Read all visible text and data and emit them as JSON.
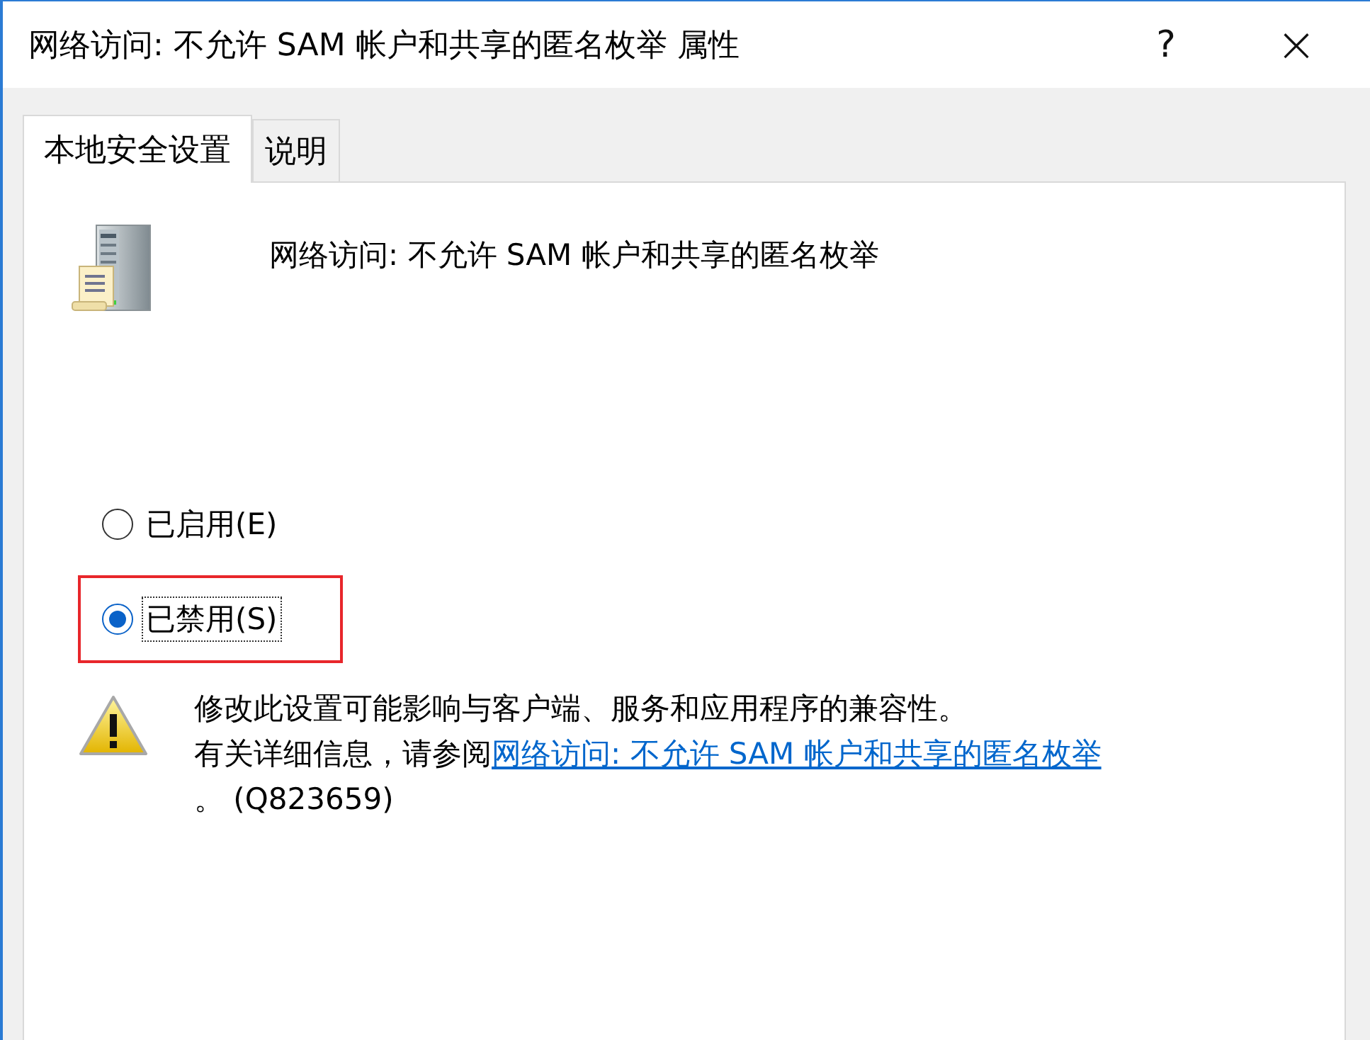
{
  "window": {
    "title": "网络访问: 不允许 SAM 帐户和共享的匿名枚举 属性",
    "help": "?",
    "close": "×"
  },
  "tabs": [
    {
      "label": "本地安全设置",
      "selected": true
    },
    {
      "label": "说明",
      "selected": false
    }
  ],
  "policy_name": "网络访问: 不允许 SAM 帐户和共享的匿名枚举",
  "options": [
    {
      "label": "已启用(E)",
      "selected": false,
      "highlighted": false
    },
    {
      "label": "已禁用(S)",
      "selected": true,
      "highlighted": true
    }
  ],
  "warning": {
    "text": "修改此设置可能影响与客户端、服务和应用程序的兼容性。",
    "info_prefix": "有关详细信息，请参阅",
    "link": "网络访问: 不允许 SAM 帐户和共享的匿名枚举",
    "suffix": "。 (Q823659)"
  }
}
